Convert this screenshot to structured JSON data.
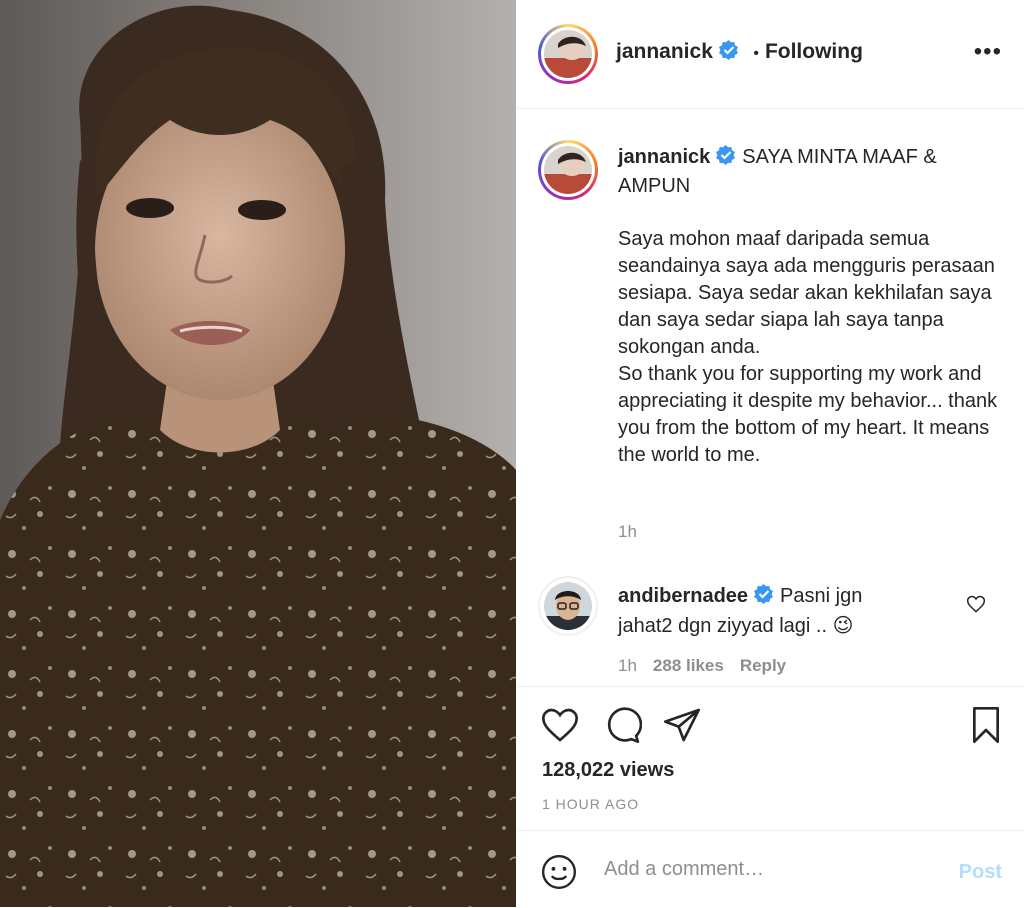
{
  "post": {
    "username": "jannanick",
    "follow_status": "Following",
    "separator": "•",
    "more_label": "•••"
  },
  "caption": {
    "username": "jannanick",
    "headline": "SAYA MINTA MAAF & AMPUN",
    "body": "Saya mohon maaf daripada semua seandainya saya ada mengguris perasaan sesiapa. Saya sedar akan kekhilafan saya dan saya sedar siapa lah saya tanpa sokongan anda.\nSo thank you for supporting my work and appreciating it despite my behavior... thank you from the bottom of my heart. It means the world to me.",
    "time": "1h"
  },
  "comment": {
    "username": "andibernadee",
    "text": "Pasni jgn jahat2 dgn ziyyad lagi .. 😉",
    "time": "1h",
    "likes": "288 likes",
    "reply_label": "Reply"
  },
  "stats": {
    "views": "128,022 views",
    "ago": "1 HOUR AGO"
  },
  "comment_bar": {
    "placeholder": "Add a comment…",
    "post_label": "Post"
  },
  "icons": {
    "like": "heart-icon",
    "comment": "speech-bubble-icon",
    "share": "paper-plane-icon",
    "save": "bookmark-icon",
    "emoji": "smiley-icon",
    "verified": "verified-badge-icon"
  },
  "colors": {
    "verified": "#3897f0",
    "post_disabled": "#b2dffc",
    "muted": "#8e8e8e"
  }
}
